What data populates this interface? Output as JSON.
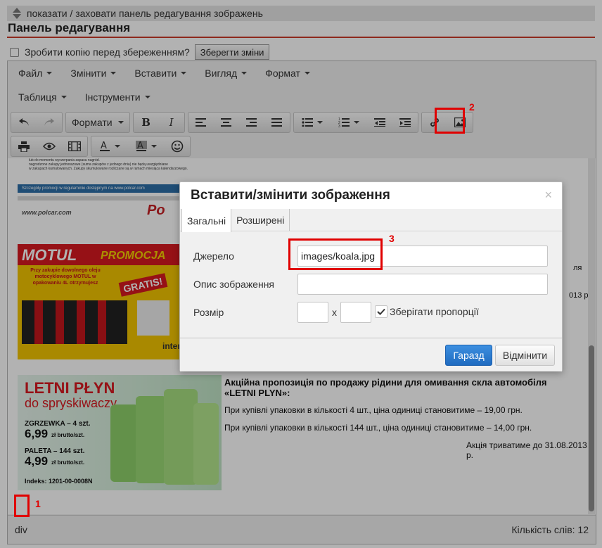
{
  "toggle_bar": {
    "label": "показати / заховати панель редагування зображень"
  },
  "panel": {
    "title": "Панель редагування"
  },
  "copy_option": {
    "label": "Зробити копію перед збереженням?",
    "save_button": "Зберегти зміни"
  },
  "menu": {
    "row1": [
      "Файл",
      "Змінити",
      "Вставити",
      "Вигляд",
      "Формат"
    ],
    "row2": [
      "Таблиця",
      "Інструменти"
    ]
  },
  "toolbar": {
    "formats_label": "Формати"
  },
  "content": {
    "small_text_1": "lub do momentu wyczerpania zapasu nagród.",
    "small_text_2": "nagrodzone zakupy jednorazowe (suma zakupów z jednego dnia) nie będą uwzględniane",
    "small_text_3": "w zakupach kumulowanych. Zakupy skumulowane rozliczane są w ramach miesiąca kalendarzowego.",
    "polcar_note": "Szczegóły promocji w regulaminie dostępnym na www.polcar.com",
    "polcar_url": "www.polcar.com",
    "polcar_logo": "Po",
    "motul_logo": "MOTUL",
    "motul_promo": "PROMOCJA",
    "motul_text": "Przy zakupie dowolnego oleju motocyklowego MOTUL w opakowaniu 4L otrzymujesz",
    "motul_gratis": "GRATIS!",
    "motul_side": "inter",
    "side_text_1": "ля",
    "side_text_2": "013 р.",
    "letni_title": "LETNI PŁYN",
    "letni_sub": "do spryskiwaczy",
    "letni_zg": "ZGRZEWKA – 4 szt.",
    "letni_zg_price": "6,99",
    "letni_unit": "zł brutto/szt.",
    "letni_pal": "PALETA – 144 szt.",
    "letni_pal_price": "4,99",
    "letni_index": "Indeks: 1201-00-0008N",
    "promo_title": "Акційна пропозиція по продажу рідини для омивання скла автомобіля «LETNI PLYN»:",
    "promo_line1": "При купівлі упаковки в кількості 4 шт., ціна одиниці становитиме – 19,00 грн.",
    "promo_line2": "При купівлі упаковки в кількості 144 шт., ціна одиниці становитиме – 14,00 грн.",
    "promo_until": "Акція триватиме до 31.08.2013 р."
  },
  "status": {
    "path": "div",
    "word_count": "Кількість слів: 12"
  },
  "dialog": {
    "title": "Вставити/змінити зображення",
    "close": "×",
    "tabs": [
      "Загальні",
      "Розширені"
    ],
    "source_label": "Джерело",
    "source_value": "images/koala.jpg",
    "description_label": "Опис зображення",
    "description_value": "",
    "size_label": "Розмір",
    "size_x": "x",
    "width_value": "",
    "height_value": "",
    "keep_proportions": "Зберігати пропорції",
    "ok": "Гаразд",
    "cancel": "Відмінити"
  },
  "annotations": {
    "n1": "1",
    "n2": "2",
    "n3": "3"
  },
  "colors": {
    "accent": "#cc3b2a",
    "primary_button": "#2a7fd4",
    "annotation": "#e00000"
  }
}
